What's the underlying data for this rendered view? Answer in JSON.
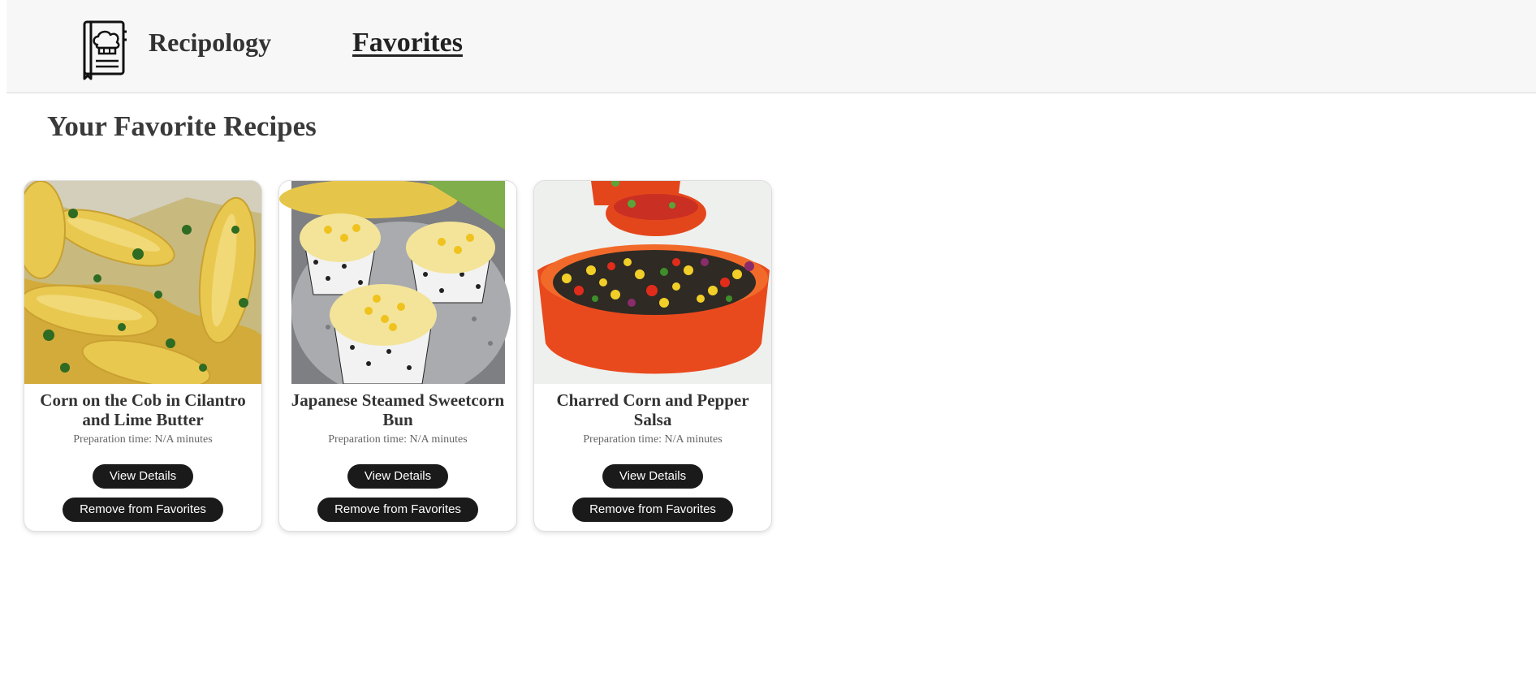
{
  "header": {
    "brand": "Recipology",
    "nav": [
      {
        "label": "Favorites",
        "active": true
      }
    ],
    "logo_icon": "chef-hat-book-icon"
  },
  "page": {
    "title": "Your Favorite Recipes"
  },
  "recipes": [
    {
      "title": "Corn on the Cob in Cilantro and Lime Butter",
      "prep_time": "Preparation time: N/A minutes",
      "view_label": "View Details",
      "remove_label": "Remove from Favorites",
      "image_icon": "corn-cob-photo"
    },
    {
      "title": "Japanese Steamed Sweetcorn Bun",
      "prep_time": "Preparation time: N/A minutes",
      "view_label": "View Details",
      "remove_label": "Remove from Favorites",
      "image_icon": "steamed-bun-photo"
    },
    {
      "title": "Charred Corn and Pepper Salsa",
      "prep_time": "Preparation time: N/A minutes",
      "view_label": "View Details",
      "remove_label": "Remove from Favorites",
      "image_icon": "corn-salsa-photo"
    }
  ],
  "colors": {
    "header_bg": "#f7f7f7",
    "button_bg": "#1a1a1a",
    "button_text": "#ffffff",
    "text": "#333333"
  }
}
